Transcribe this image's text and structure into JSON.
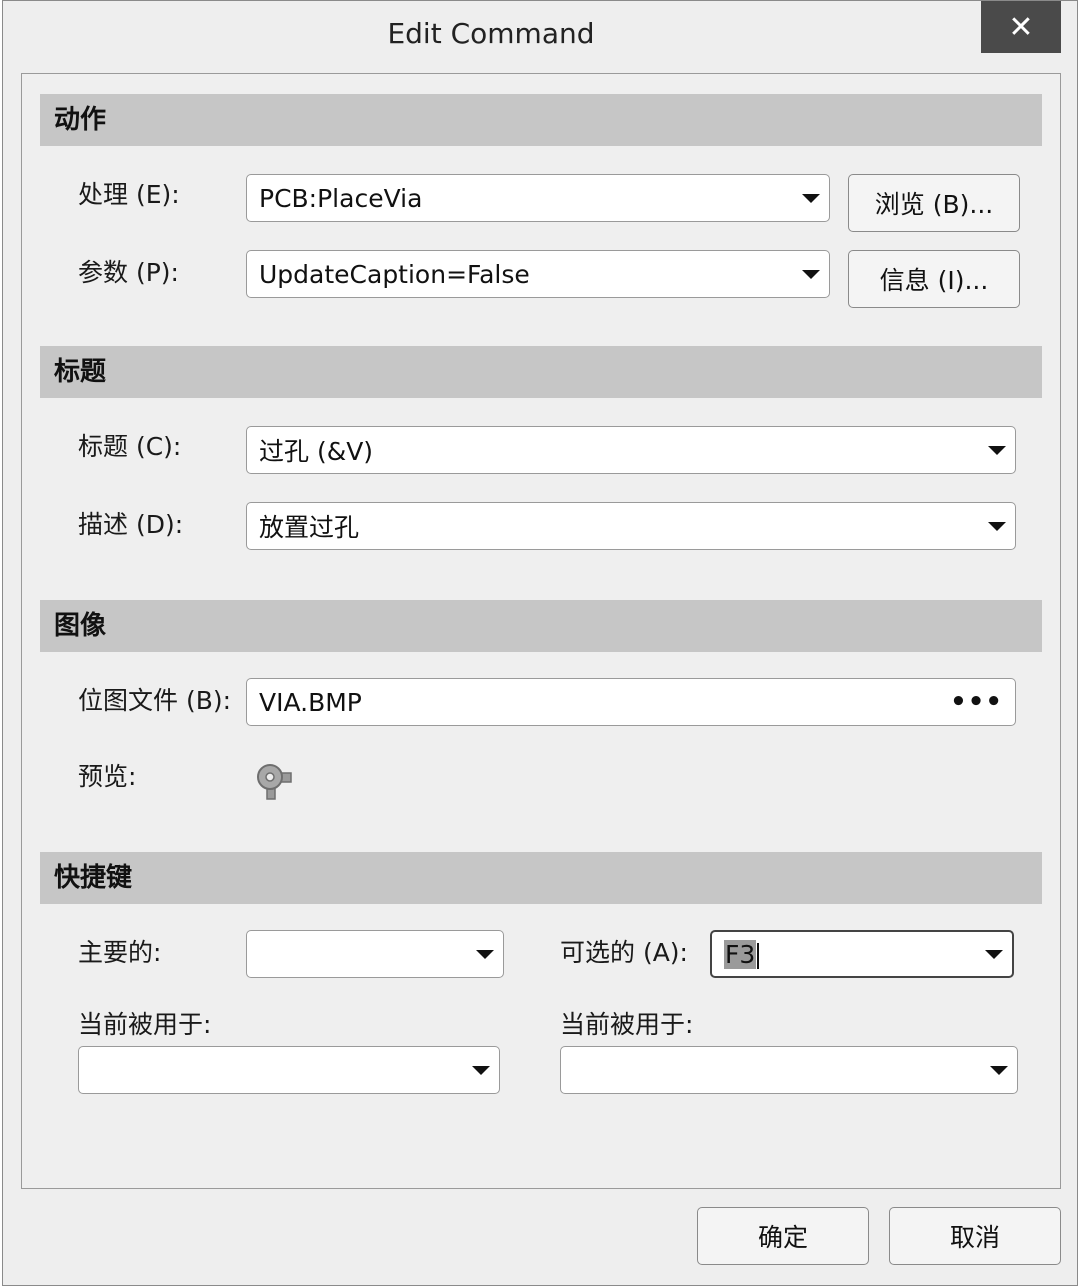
{
  "window": {
    "title": "Edit Command",
    "close_label": "✕"
  },
  "sections": {
    "action": "动作",
    "caption": "标题",
    "image": "图像",
    "shortcut": "快捷键"
  },
  "action": {
    "process_label": "处理 (E):",
    "process_value": "PCB:PlaceVia",
    "browse_button": "浏览 (B)...",
    "params_label": "参数 (P):",
    "params_value": "UpdateCaption=False",
    "info_button": "信息 (I)..."
  },
  "caption": {
    "caption_label": "标题 (C):",
    "caption_value": "过孔 (&V)",
    "desc_label": "描述 (D):",
    "desc_value": "放置过孔"
  },
  "image": {
    "bitmap_label": "位图文件 (B):",
    "bitmap_value": "VIA.BMP",
    "browse_dots": "•••",
    "preview_label": "预览:",
    "preview_icon": "via-icon"
  },
  "shortcut": {
    "primary_label": "主要的:",
    "primary_value": "",
    "alternative_label": "可选的 (A):",
    "alternative_value": "F3",
    "used_by_left_label": "当前被用于:",
    "used_by_left_value": "",
    "used_by_right_label": "当前被用于:",
    "used_by_right_value": ""
  },
  "footer": {
    "ok_button": "确定",
    "cancel_button": "取消"
  }
}
